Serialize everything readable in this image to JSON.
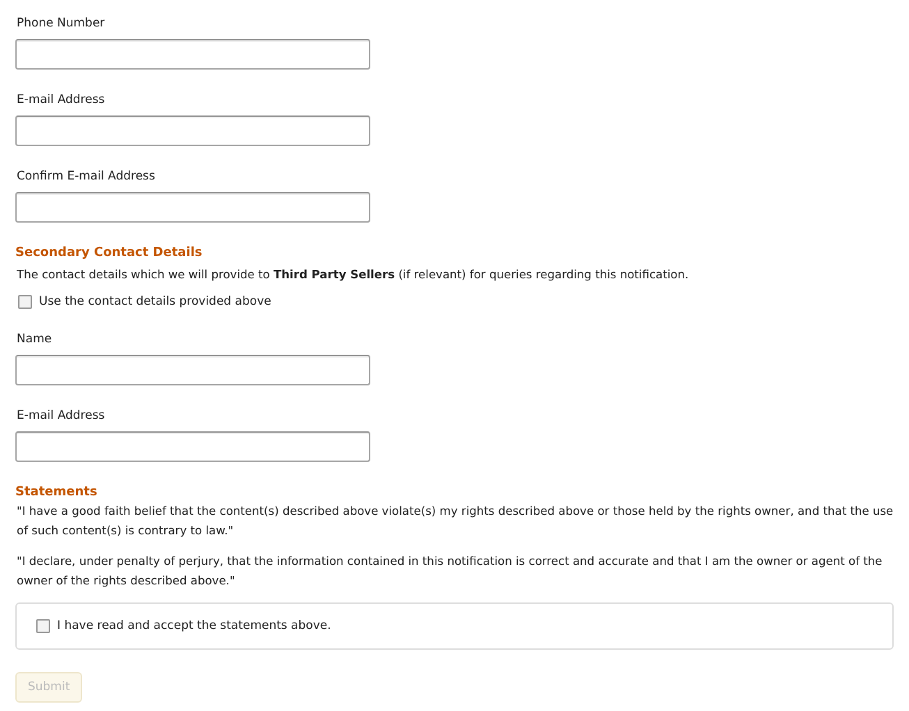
{
  "primary_fields": [
    {
      "label": "Phone Number"
    },
    {
      "label": "E-mail Address"
    },
    {
      "label": "Confirm E-mail Address"
    }
  ],
  "secondary": {
    "heading": "Secondary Contact Details",
    "description": "The contact details which we will provide to **Third Party Sellers** (if relevant) for queries regarding this notification.",
    "use_above": {
      "label": "Use the contact details provided above",
      "checked": false
    },
    "fields": [
      {
        "label": "Name"
      },
      {
        "label": "E-mail Address"
      }
    ]
  },
  "statements": {
    "heading": "Statements",
    "paragraphs": [
      "\"I have a good faith belief that the content(s) described above violate(s) my rights described above or those held by the rights owner, and that the use of such content(s) is contrary to law.\"",
      "\"I declare, under penalty of perjury, that the information contained in this notification is correct and accurate and that I am the owner or agent of the owner of the rights described above.\""
    ],
    "accept": {
      "label": "I have read and accept the statements above.",
      "checked": false
    }
  },
  "submit": {
    "label": "Submit",
    "disabled": true
  }
}
